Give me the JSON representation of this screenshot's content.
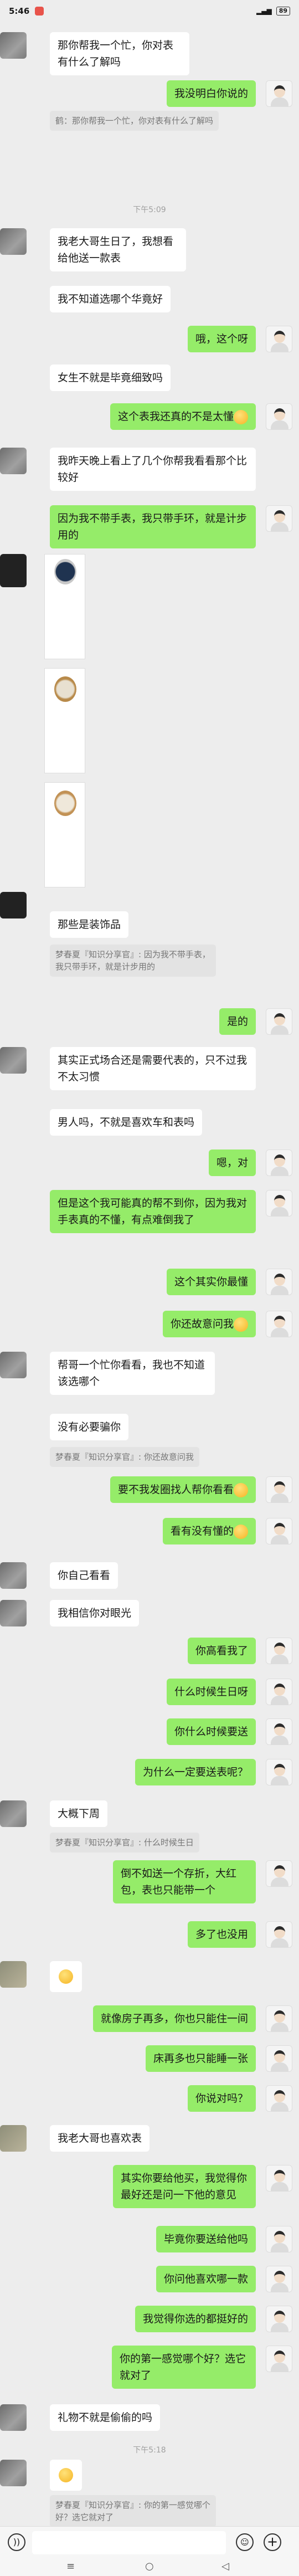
{
  "status_bar": {
    "time": "5:46",
    "battery": "89"
  },
  "times": [
    "下午5:09",
    "下午5:18"
  ],
  "messages": {
    "m1": "那你帮我一个忙，你对表有什么了解吗",
    "m2": "我没明白你说的",
    "q1": "鹤：那你帮我一个忙，你对表有什么了解吗",
    "m3": "我老大哥生日了，我想看给他送一款表",
    "m4": "我不知道选哪个华竟好",
    "m5": "哦，这个呀",
    "m6": "女生不就是毕竟细致吗",
    "m7": "这个表我还真的不是太懂",
    "m8": "我昨天晚上看上了几个你帮我看看那个比较好",
    "m9": "因为我不带手表，我只带手环，就是计步用的",
    "m10": "那些是装饰品",
    "q2": "梦春夏『知识分享官』: 因为我不带手表，我只带手环，就是计步用的",
    "m11": "是的",
    "m12": "其实正式场合还是需要代表的，只不过我不太习惯",
    "m13": "男人吗，不就是喜欢车和表吗",
    "m14": "嗯，对",
    "m15": "但是这个我可能真的帮不到你，因为我对手表真的不懂，有点难倒我了",
    "m16": "这个其实你最懂",
    "m17": "你还故意问我",
    "m18": "帮哥一个忙你看看，我也不知道该选哪个",
    "m19": "没有必要骗你",
    "q3": "梦春夏『知识分享官』: 你还故意问我",
    "m20": "要不我发圈找人帮你看看",
    "m21": "看有没有懂的",
    "m22": "你自己看看",
    "m23": "我相信你对眼光",
    "m24": "你高看我了",
    "m25": "什么时候生日呀",
    "m26": "你什么时候要送",
    "m27": "为什么一定要送表呢？",
    "m28": "大概下周",
    "q4": "梦春夏『知识分享官』: 什么时候生日",
    "m29": "倒不如送一个存折，大红包，表也只能带一个",
    "m30": "多了也没用",
    "m31": "就像房子再多，你也只能住一间",
    "m32": "床再多也只能睡一张",
    "m33": "你说对吗？",
    "m34": "我老大哥也喜欢表",
    "m35": "其实你要给他买，我觉得你最好还是问一下他的意见",
    "m36": "毕竟你要送给他吗",
    "m37": "你问他喜欢哪一款",
    "m38": "我觉得你选的都挺好的",
    "m39": "你的第一感觉哪个好？选它就对了",
    "m40": "礼物不就是偷偷的吗",
    "q5": "梦春夏『知识分享官』: 你的第一感觉哪个好？选它就对了"
  },
  "icons": [
    "voice-icon",
    "emoji-icon",
    "plus-icon",
    "menu-icon",
    "home-icon",
    "back-icon"
  ],
  "colors": {
    "bubble_right": "#95ec69",
    "bubble_left": "#ffffff",
    "background": "#ededed"
  }
}
